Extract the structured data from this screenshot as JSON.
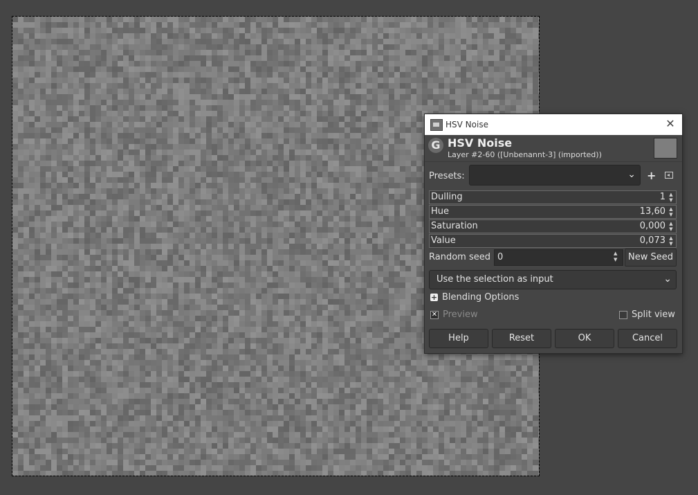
{
  "dialog": {
    "window_title": "HSV Noise",
    "heading": "HSV Noise",
    "subheading": "Layer #2-60 ([Unbenannt-3] (imported))",
    "presets_label": "Presets:",
    "presets_value": "",
    "params": [
      {
        "name": "Dulling",
        "value": "1",
        "fraction": 0.0
      },
      {
        "name": "Hue",
        "value": "13,60",
        "fraction": 0.0
      },
      {
        "name": "Saturation",
        "value": "0,000",
        "fraction": 0.0
      },
      {
        "name": "Value",
        "value": "0,073",
        "fraction": 0.0
      }
    ],
    "random_seed_label": "Random seed",
    "random_seed_value": "0",
    "new_seed_label": "New Seed",
    "input_mode": "Use the selection as input",
    "blending_options_label": "Blending Options",
    "preview_label": "Preview",
    "split_view_label": "Split view",
    "buttons": {
      "help": "Help",
      "reset": "Reset",
      "ok": "OK",
      "cancel": "Cancel"
    }
  },
  "colors": {
    "workspace_bg": "#454545",
    "canvas_gray": "#7a7a7a",
    "dialog_bg": "#454545"
  },
  "icons": {
    "close": "close-icon",
    "gimp": "gimp-logo-icon",
    "presets_add": "plus-icon",
    "presets_menu": "menu-arrow-icon",
    "dropdown": "chevron-down-icon"
  }
}
